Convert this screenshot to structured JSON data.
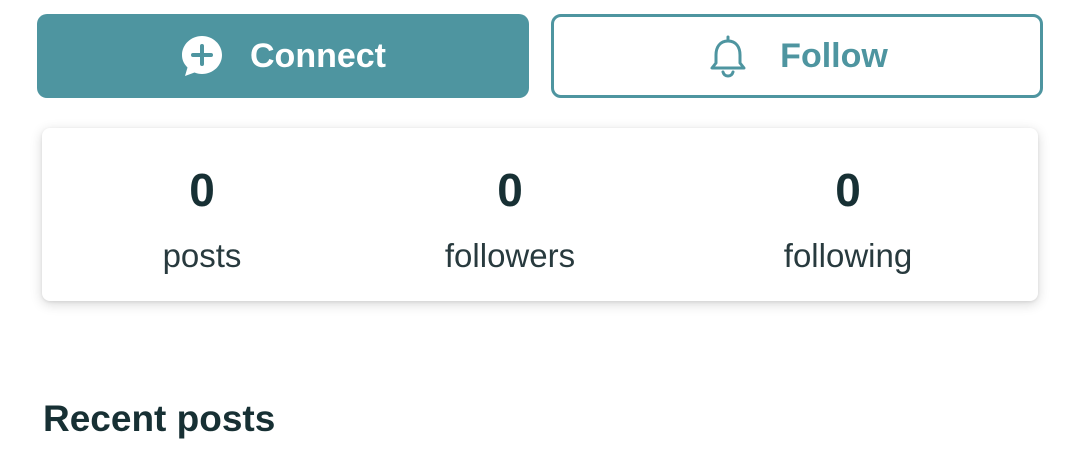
{
  "actions": {
    "connect": {
      "label": "Connect",
      "icon": "chat-plus-icon"
    },
    "follow": {
      "label": "Follow",
      "icon": "bell-icon"
    }
  },
  "stats": {
    "posts": {
      "value": "0",
      "label": "posts"
    },
    "followers": {
      "value": "0",
      "label": "followers"
    },
    "following": {
      "value": "0",
      "label": "following"
    }
  },
  "recent_posts": {
    "title": "Recent posts"
  },
  "colors": {
    "accent": "#4e95a0",
    "text_dark": "#173034",
    "background": "#ffffff"
  }
}
